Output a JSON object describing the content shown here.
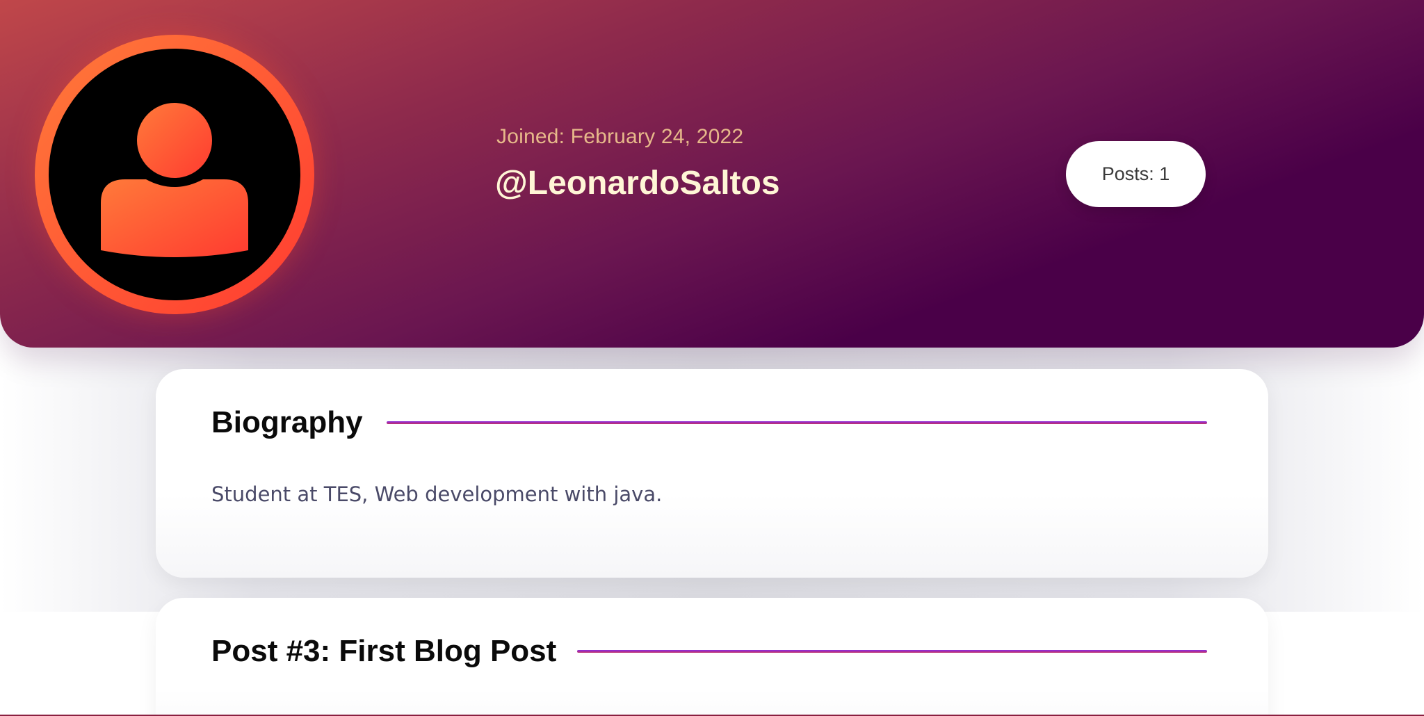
{
  "profile": {
    "joined": "Joined: February 24, 2022",
    "username": "@LeonardoSaltos",
    "posts": "Posts: 1",
    "avatar_icon": "user-silhouette-icon"
  },
  "biography": {
    "title": "Biography",
    "text": "Student at TES, Web development with java."
  },
  "posts": [
    {
      "title": "Post #3: First Blog Post"
    }
  ],
  "colors": {
    "header_start": "#c0474a",
    "header_end": "#4a0048",
    "accent_orange": "#ff7a3a",
    "accent_red": "#ff3b30",
    "joined_text": "#e7b98a",
    "username_text": "#fff6d6",
    "line_purple": "#8a2be2"
  }
}
